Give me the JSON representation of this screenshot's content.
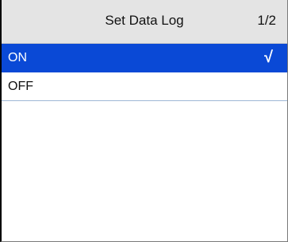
{
  "header": {
    "title": "Set Data Log",
    "page_indicator": "1/2"
  },
  "options": [
    {
      "label": "ON",
      "selected": true,
      "check_mark": "√"
    },
    {
      "label": "OFF",
      "selected": false,
      "check_mark": ""
    }
  ],
  "colors": {
    "header_background": "#e4e4e4",
    "selected_background": "#0a49d6",
    "selected_text": "#ffffff",
    "row_divider": "#9fb7d6"
  }
}
